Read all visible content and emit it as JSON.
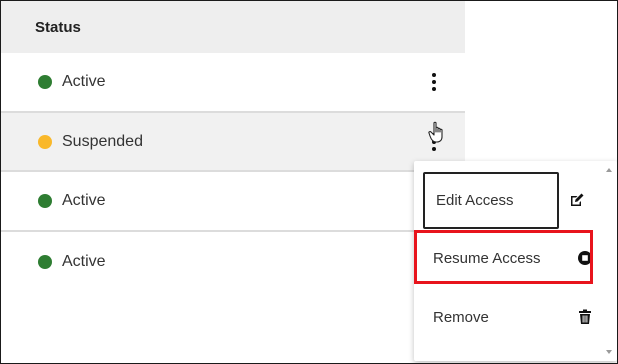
{
  "table": {
    "header": "Status",
    "rows": [
      {
        "status": "Active",
        "color": "#2e7d32"
      },
      {
        "status": "Suspended",
        "color": "#f9b82a"
      },
      {
        "status": "Active",
        "color": "#2e7d32"
      },
      {
        "status": "Active",
        "color": "#2e7d32"
      }
    ]
  },
  "menu": {
    "items": [
      {
        "label": "Edit Access",
        "icon": "edit-icon"
      },
      {
        "label": "Resume Access",
        "icon": "resume-icon"
      },
      {
        "label": "Remove",
        "icon": "trash-icon"
      }
    ],
    "highlight_color": "#e8141c"
  }
}
